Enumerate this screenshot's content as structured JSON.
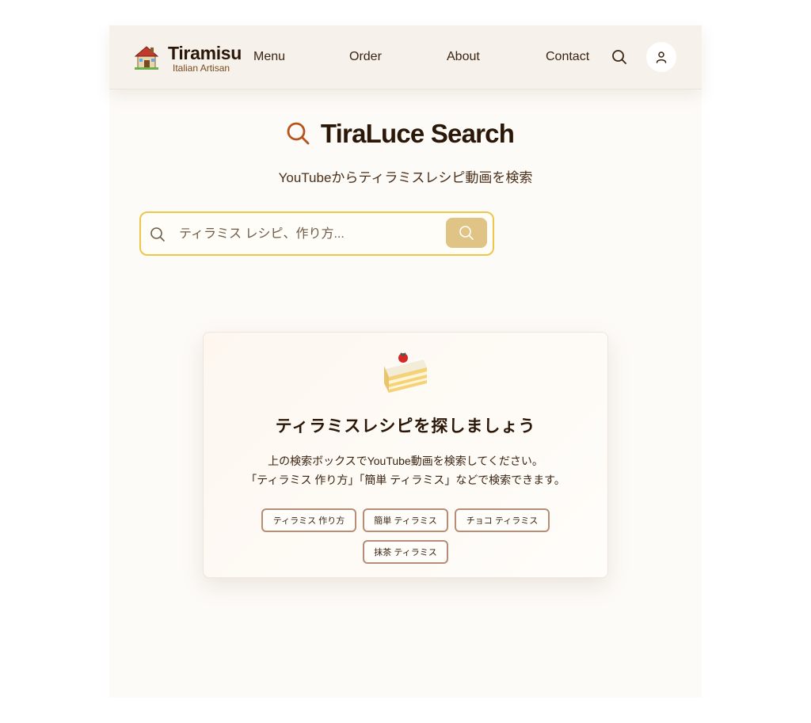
{
  "header": {
    "brand_title": "Tiramisu",
    "brand_subtitle": "Italian Artisan",
    "nav": [
      "Menu",
      "Order",
      "About",
      "Contact"
    ],
    "icons": {
      "logo": "house-icon",
      "search": "search-icon",
      "account": "user-icon"
    }
  },
  "hero": {
    "title": "TiraLuce Search",
    "subtitle": "YouTubeからティラミスレシピ動画を検索"
  },
  "search": {
    "placeholder": "ティラミス レシピ、作り方...",
    "value": ""
  },
  "empty_state": {
    "icon": "cake-icon",
    "title": "ティラミスレシピを探しましょう",
    "line1": "上の検索ボックスでYouTube動画を検索してください。",
    "line2": "「ティラミス 作り方」「簡単 ティラミス」などで検索できます。",
    "suggestions": [
      "ティラミス 作り方",
      "簡単 ティラミス",
      "チョコ ティラミス",
      "抹茶 ティラミス"
    ]
  },
  "colors": {
    "accent": "#b5541c",
    "search_border": "#f0c64a",
    "search_button": "#dfc486",
    "header_bg": "#f6f1ea",
    "text": "#3a2412"
  }
}
